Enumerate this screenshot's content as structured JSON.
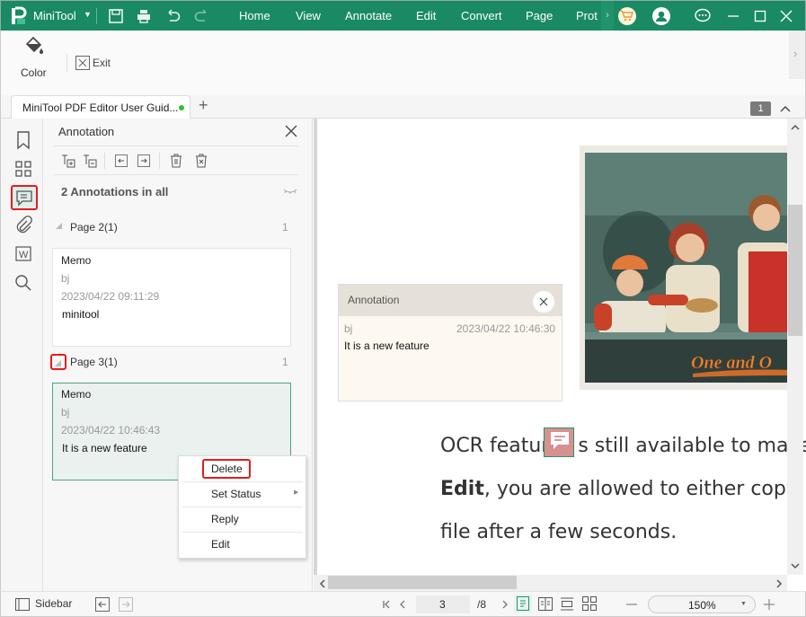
{
  "titlebar": {
    "app_name": "MiniTool",
    "menus": [
      "Home",
      "View",
      "Annotate",
      "Edit",
      "Convert",
      "Page",
      "Prot"
    ],
    "icons": [
      "save-icon",
      "print-icon",
      "undo-icon",
      "redo-icon",
      "cart-icon",
      "account-icon",
      "feedback-icon",
      "minimize-icon",
      "maximize-icon",
      "close-icon"
    ]
  },
  "ribbon": {
    "color_label": "Color",
    "exit_label": "Exit"
  },
  "tabs": {
    "doc_tab_title": "MiniTool PDF Editor User Guid...",
    "page_badge": "1",
    "new_tab": "+"
  },
  "panel": {
    "title": "Annotation",
    "summary": "2 Annotations in all",
    "groups": [
      {
        "label": "Page 2(1)",
        "count": "1",
        "items": [
          {
            "type": "Memo",
            "author": "bj",
            "timestamp": "2023/04/22 09:11:29",
            "content": "minitool"
          }
        ]
      },
      {
        "label": "Page 3(1)",
        "count": "1",
        "items": [
          {
            "type": "Memo",
            "author": "bj",
            "timestamp": "2023/04/22 10:46:43",
            "content": "It is a new feature"
          }
        ]
      }
    ]
  },
  "context_menu": {
    "items": [
      "Delete",
      "Set Status",
      "Reply",
      "Edit"
    ]
  },
  "popup": {
    "title": "Annotation",
    "author": "bj",
    "timestamp": "2023/04/22 10:46:30",
    "content": "It is a new feature"
  },
  "document": {
    "line1": "OCR featur",
    "line1_rest": "s still available to make",
    "line2_bold": "Edit",
    "line2_rest": ", you are allowed to either copy",
    "line3": "file after a few seconds.",
    "image_caption": "One and O"
  },
  "statusbar": {
    "sidebar_label": "Sidebar",
    "current_page": "3",
    "total_pages": "/8",
    "zoom": "150%"
  },
  "colors": {
    "brand": "#1a8a64",
    "highlight_red": "#e41c1c",
    "selected_card": "#eaf1ef",
    "note_icon": "#d98f8f"
  }
}
